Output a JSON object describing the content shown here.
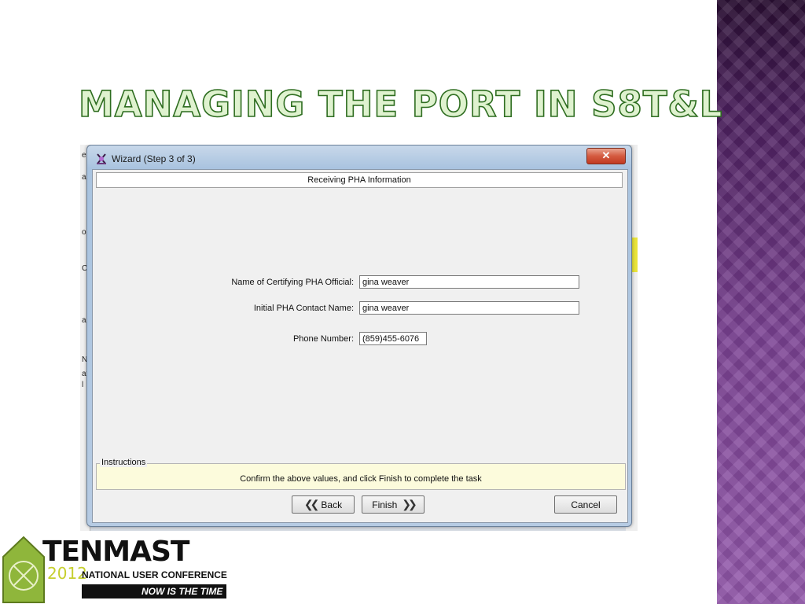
{
  "slide": {
    "title": "MANAGING THE PORT IN S8T&L"
  },
  "background_app": {
    "left_glyphs": [
      "e",
      "a",
      "o",
      "C",
      "a",
      "N",
      "at",
      "l"
    ]
  },
  "wizard": {
    "window_title": "Wizard (Step 3 of 3)",
    "close_label": "✕",
    "section_header": "Receiving PHA Information",
    "fields": {
      "official_label": "Name of Certifying PHA Official:",
      "official_value": "gina weaver",
      "contact_label": "Initial PHA Contact Name:",
      "contact_value": "gina weaver",
      "phone_label": "Phone Number:",
      "phone_value": "(859)455-6076"
    },
    "instructions": {
      "title": "Instructions",
      "text": "Confirm the above values, and click Finish to complete the task"
    },
    "buttons": {
      "back": "Back",
      "finish": "Finish",
      "cancel": "Cancel"
    }
  },
  "logo": {
    "brand": "TENMAST",
    "year": "2012",
    "conference": "NATIONAL USER CONFERENCE",
    "tagline": "NOW IS THE TIME"
  },
  "colors": {
    "title_fill": "#dff2cf",
    "title_outline": "#2e6d20",
    "side_band": "#6f3a86",
    "instructions_bg": "#fcfbdc",
    "close_button": "#c23a22",
    "logo_accent": "#8fb63b"
  },
  "icons": {
    "app": "wizard-app-icon",
    "back": "double-chevron-left-icon",
    "finish": "double-chevron-right-icon"
  }
}
